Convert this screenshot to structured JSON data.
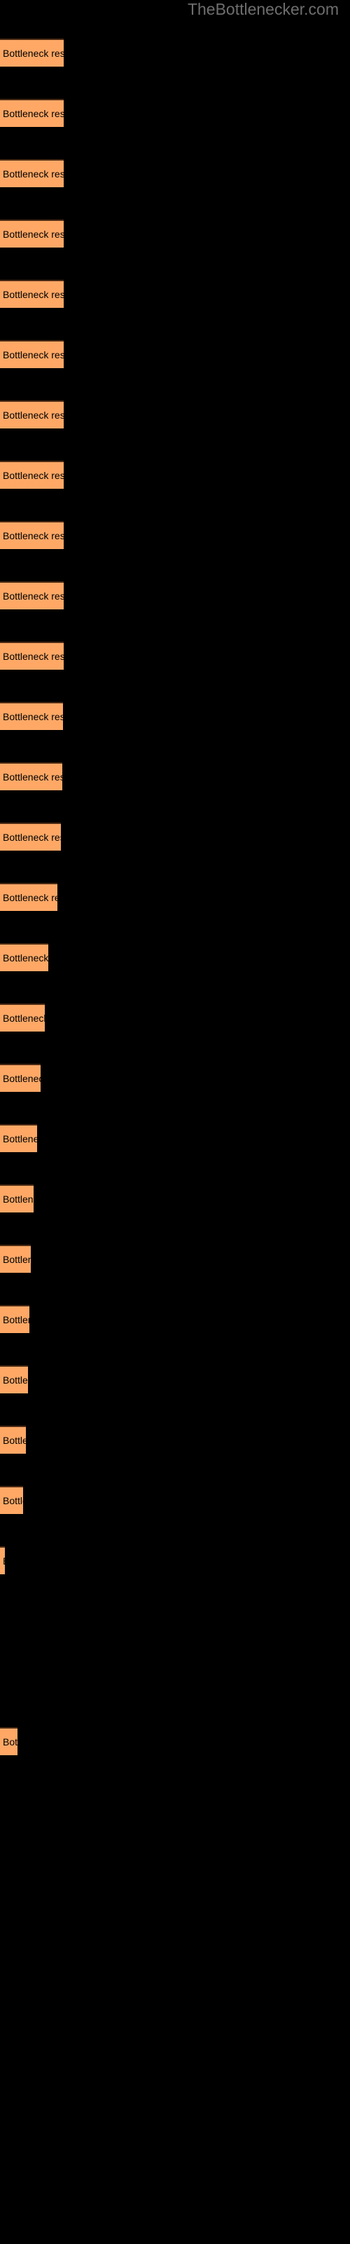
{
  "watermark": {
    "text": "TheBottlenecker.com",
    "color": "#6e6e6e"
  },
  "style": {
    "background": "#000000",
    "bar_fill": "#ffa866",
    "bar_border": "#4a2a14",
    "label_color": "#000000"
  },
  "chart_data": {
    "type": "bar",
    "orientation": "horizontal",
    "title": "",
    "subtitle": "",
    "xlabel": "",
    "ylabel": "",
    "grid": false,
    "legend": null,
    "xlim": [
      0,
      100
    ],
    "bar_label_text": "Bottleneck result",
    "categories": [
      "bar-1",
      "bar-2",
      "bar-3",
      "bar-4",
      "bar-5",
      "bar-6",
      "bar-7",
      "bar-8",
      "bar-9",
      "bar-10",
      "bar-11",
      "bar-12",
      "bar-13",
      "bar-14",
      "bar-15",
      "bar-16",
      "bar-17",
      "bar-18",
      "bar-19",
      "bar-20",
      "bar-21",
      "bar-22",
      "bar-23",
      "bar-24",
      "bar-25",
      "bar-26",
      "bar-27",
      "bar-28",
      "bar-29"
    ],
    "values": [
      91,
      91,
      91,
      91,
      91,
      91,
      91,
      91,
      91,
      91,
      91,
      90,
      89,
      87,
      82,
      69,
      64,
      58,
      53,
      48,
      44,
      42,
      40,
      37,
      33,
      7,
      0,
      0,
      25
    ],
    "bars": [
      {
        "id": "bar-1",
        "label": "Bottleneck result",
        "width": 91,
        "y": 55
      },
      {
        "id": "bar-2",
        "label": "Bottleneck result",
        "width": 91,
        "y": 141
      },
      {
        "id": "bar-3",
        "label": "Bottleneck result",
        "width": 91,
        "y": 227
      },
      {
        "id": "bar-4",
        "label": "Bottleneck result",
        "width": 91,
        "y": 313
      },
      {
        "id": "bar-5",
        "label": "Bottleneck result",
        "width": 91,
        "y": 399
      },
      {
        "id": "bar-6",
        "label": "Bottleneck result",
        "width": 91,
        "y": 485
      },
      {
        "id": "bar-7",
        "label": "Bottleneck result",
        "width": 91,
        "y": 571
      },
      {
        "id": "bar-8",
        "label": "Bottleneck result",
        "width": 91,
        "y": 657
      },
      {
        "id": "bar-9",
        "label": "Bottleneck result",
        "width": 91,
        "y": 743
      },
      {
        "id": "bar-10",
        "label": "Bottleneck result",
        "width": 91,
        "y": 829
      },
      {
        "id": "bar-11",
        "label": "Bottleneck result",
        "width": 91,
        "y": 915
      },
      {
        "id": "bar-12",
        "label": "Bottleneck result",
        "width": 90,
        "y": 1001
      },
      {
        "id": "bar-13",
        "label": "Bottleneck result",
        "width": 89,
        "y": 1087
      },
      {
        "id": "bar-14",
        "label": "Bottleneck result",
        "width": 87,
        "y": 1173
      },
      {
        "id": "bar-15",
        "label": "Bottleneck result",
        "width": 82,
        "y": 1259
      },
      {
        "id": "bar-16",
        "label": "Bottleneck result",
        "width": 69,
        "y": 1345
      },
      {
        "id": "bar-17",
        "label": "Bottleneck result",
        "width": 64,
        "y": 1431
      },
      {
        "id": "bar-18",
        "label": "Bottleneck result",
        "width": 58,
        "y": 1517
      },
      {
        "id": "bar-19",
        "label": "Bottleneck result",
        "width": 53,
        "y": 1603
      },
      {
        "id": "bar-20",
        "label": "Bottleneck result",
        "width": 48,
        "y": 1689
      },
      {
        "id": "bar-21",
        "label": "Bottleneck result",
        "width": 44,
        "y": 1775
      },
      {
        "id": "bar-22",
        "label": "Bottleneck result",
        "width": 42,
        "y": 1861
      },
      {
        "id": "bar-23",
        "label": "Bottleneck result",
        "width": 40,
        "y": 1947
      },
      {
        "id": "bar-24",
        "label": "Bottleneck result",
        "width": 37,
        "y": 2033
      },
      {
        "id": "bar-25",
        "label": "Bottleneck result",
        "width": 33,
        "y": 2119
      },
      {
        "id": "bar-26",
        "label": "Bottleneck result",
        "width": 7,
        "y": 2205
      },
      {
        "id": "bar-27",
        "label": "Bottleneck result",
        "width": 0,
        "y": 2291
      },
      {
        "id": "bar-28",
        "label": "Bottleneck result",
        "width": 0,
        "y": 2377
      },
      {
        "id": "bar-29",
        "label": "Bottleneck result",
        "width": 25,
        "y": 2463
      }
    ]
  }
}
